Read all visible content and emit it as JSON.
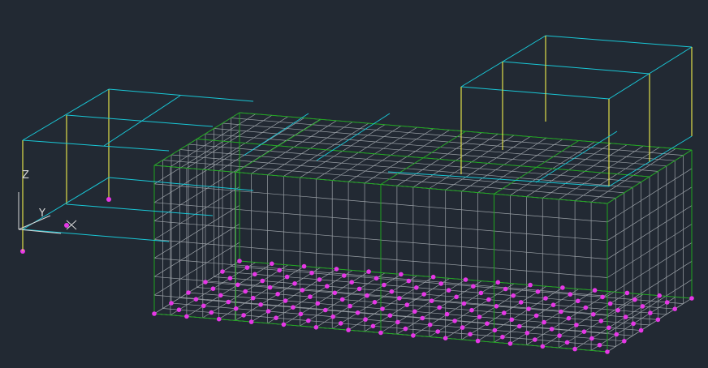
{
  "viewport": {
    "background": "#222933",
    "colors": {
      "mesh": "#9aa0a6",
      "boundary": "#1fa51f",
      "beam": "#19c7d6",
      "column": "#e0e04a",
      "node": "#e637e6",
      "ucs": "#d7d7d7"
    }
  },
  "ucs": {
    "z_label": "Z",
    "y_label": "Y",
    "x_label": "X"
  }
}
